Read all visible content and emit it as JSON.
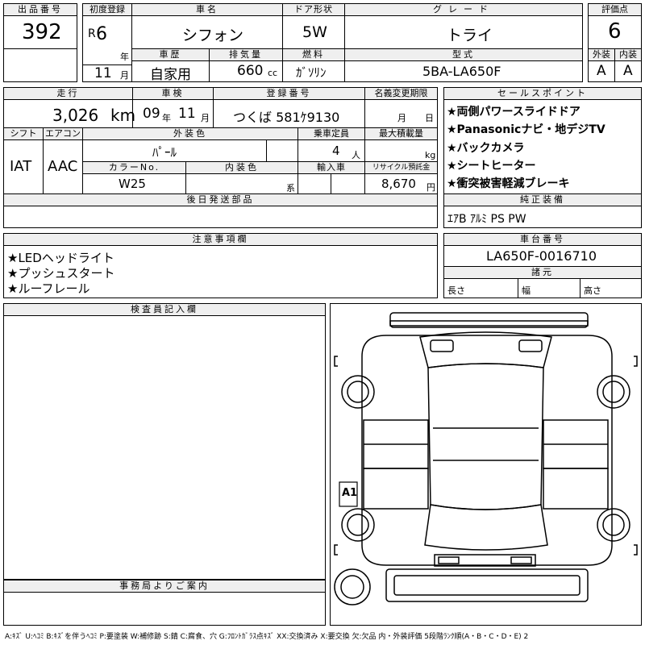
{
  "header": {
    "lot_no_label": "出品番号",
    "lot_no": "392",
    "first_reg_label": "初度登録",
    "era": "R",
    "year": "6",
    "year_unit": "年",
    "month": "11",
    "month_unit": "月",
    "car_name_label": "車名",
    "car_name": "シフォン",
    "door_label": "ドア形状",
    "door": "5W",
    "grade_label": "グレード",
    "grade": "トライ",
    "score_label": "評価点",
    "score": "6",
    "history_label": "車歴",
    "history": "自家用",
    "displacement_label": "排気量",
    "displacement": "660",
    "displacement_unit": "cc",
    "fuel_label": "燃料",
    "fuel": "ｶﾞｿﾘﾝ",
    "model_label": "型式",
    "model": "5BA-LA650F",
    "exterior_label": "外装",
    "exterior": "A",
    "interior_label": "内装",
    "interior": "A"
  },
  "row2": {
    "mileage_label": "走行",
    "mileage": "3,026",
    "mileage_unit": "km",
    "inspection_label": "車検",
    "insp_year": "09",
    "insp_year_unit": "年",
    "insp_month": "11",
    "insp_month_unit": "月",
    "plate_label": "登録番号",
    "plate": "つくば 581ｹ9130",
    "transfer_label": "名義変更期限",
    "transfer_month_unit": "月",
    "transfer_day_unit": "日",
    "shift_label": "シフト",
    "shift": "IAT",
    "ac_label": "エアコン",
    "ac": "AAC",
    "ext_color_label": "外装色",
    "ext_color": "ﾊﾟｰﾙ",
    "capacity_label": "乗車定員",
    "capacity": "4",
    "capacity_unit": "人",
    "load_label": "最大積載量",
    "load_unit": "kg",
    "color_no_label": "カラーNo.",
    "color_no": "W25",
    "int_color_label": "内装色",
    "int_color_unit": "系",
    "import_label": "輸入車",
    "recycle_label": "リサイクル預託金",
    "recycle": "8,670",
    "recycle_unit": "円",
    "parts_label": "後日発送部品"
  },
  "sales_points": {
    "label": "セールスポイント",
    "items": [
      "★両側パワースライドドア",
      "★Panasonicナビ・地デジTV",
      "★バックカメラ",
      "★シートヒーター",
      "★衝突被害軽減ブレーキ"
    ]
  },
  "equipment": {
    "label": "純正装備",
    "value": "ｴｱB ｱﾙﾐ PS PW"
  },
  "notes": {
    "label": "注意事項欄",
    "items": [
      "★LEDヘッドライト",
      "★プッシュスタート",
      "★ルーフレール"
    ]
  },
  "chassis": {
    "label": "車台番号",
    "value": "LA650F-0016710",
    "specs_label": "諸元",
    "length_label": "長さ",
    "width_label": "幅",
    "height_label": "高さ"
  },
  "inspector": {
    "label": "検査員記入欄"
  },
  "office": {
    "label": "事務局よりご案内"
  },
  "diagram": {
    "mark": "A1"
  },
  "legend": "A:ｷｽﾞ U:ﾍｺﾐ B:ｷｽﾞを伴うﾍｺﾐ P:要塗装 W:補修跡 S:錆 C:腐食、穴 G:ﾌﾛﾝﾄｶﾞﾗｽ点ｷｽﾞ XX:交換済み X:要交換 欠:欠品 内・外装評価 5段階ﾗﾝｸ順(A・B・C・D・E) 2"
}
